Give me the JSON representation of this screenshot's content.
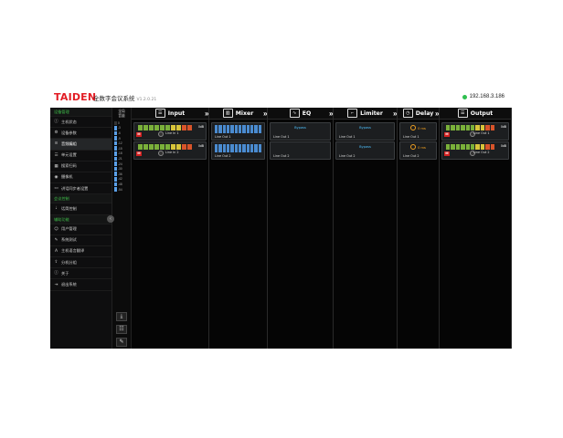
{
  "header": {
    "logo": "TAIDEN",
    "title": "全数字会议系统",
    "version": "V1.2.0.21",
    "ip": "192.168.3.186"
  },
  "sidebar": {
    "sections": [
      {
        "title": "设备管理",
        "items": [
          {
            "icon": "info-icon",
            "label": "主机状态",
            "active": false
          },
          {
            "icon": "gear-icon",
            "label": "设备参数",
            "active": false
          },
          {
            "icon": "sliders-icon",
            "label": "音频编组",
            "active": true
          },
          {
            "icon": "list-icon",
            "label": "单元设置",
            "active": false
          },
          {
            "icon": "grid-icon",
            "label": "搜索扫码",
            "active": false
          },
          {
            "icon": "camera-icon",
            "label": "摄像机",
            "active": false
          },
          {
            "icon": "screen-icon",
            "label": "讲话同步者设置",
            "active": false
          }
        ]
      },
      {
        "title": "会议控制",
        "items": [
          {
            "icon": "mic-icon",
            "label": "话筒控制",
            "active": false
          }
        ]
      },
      {
        "title": "辅助功能",
        "items": [
          {
            "icon": "users-icon",
            "label": "用户管理",
            "active": false
          },
          {
            "icon": "wrench-icon",
            "label": "系统测试",
            "active": false
          },
          {
            "icon": "translate-icon",
            "label": "主机语言翻译",
            "active": false
          },
          {
            "icon": "share-icon",
            "label": "分机分组",
            "active": false
          },
          {
            "icon": "about-icon",
            "label": "关于",
            "active": false
          },
          {
            "icon": "exit-icon",
            "label": "退出系统",
            "active": false
          }
        ]
      }
    ]
  },
  "strip": {
    "head1": "全局",
    "head2": "音量",
    "scale": [
      "0",
      "-3",
      "-6",
      "-9",
      "-12",
      "-15",
      "-18",
      "-21",
      "-24",
      "-30",
      "-36",
      "-42",
      "-48",
      "-54"
    ],
    "level_fraction": 0.93
  },
  "modules": [
    {
      "name": "Input",
      "icon": "input-icon",
      "cards": [
        {
          "label": "Line In 1",
          "db": "0dB",
          "meter": [
            "-54",
            "-48",
            "-42",
            "-36",
            "-30",
            "-24",
            "-18",
            "-12",
            "-6",
            "0"
          ]
        },
        {
          "label": "Line In 2",
          "db": "0dB",
          "meter": [
            "-54",
            "-48",
            "-42",
            "-36",
            "-30",
            "-24",
            "-18",
            "-12",
            "-6",
            "0"
          ]
        }
      ]
    },
    {
      "name": "Mixer",
      "icon": "mixer-icon",
      "cards": [
        {
          "label": "Line Out 1"
        },
        {
          "label": "Line Out 2"
        }
      ]
    },
    {
      "name": "EQ",
      "icon": "eq-icon",
      "cards": [
        {
          "label": "Line Out 1",
          "mid": "Bypass"
        },
        {
          "label": "Line Out 2",
          "mid": ""
        }
      ]
    },
    {
      "name": "Limiter",
      "icon": "limiter-icon",
      "cards": [
        {
          "label": "Line Out 1",
          "mid": "Bypass"
        },
        {
          "label": "Line Out 2",
          "mid": "Bypass"
        }
      ]
    },
    {
      "name": "Delay",
      "icon": "delay-icon",
      "cards": [
        {
          "label": "Line Out 1",
          "mid": "0 ms"
        },
        {
          "label": "Line Out 2",
          "mid": "0 ms"
        }
      ]
    },
    {
      "name": "Output",
      "icon": "output-icon",
      "cards": [
        {
          "label": "Line Out 1",
          "db": "0dB"
        },
        {
          "label": "Line Out 2",
          "db": "0dB"
        }
      ]
    }
  ],
  "colors": {
    "brand": "#e21c24",
    "accent_green": "#3fbf4a",
    "accent_blue": "#4fc2ff",
    "delay_orange": "#f0a020"
  }
}
